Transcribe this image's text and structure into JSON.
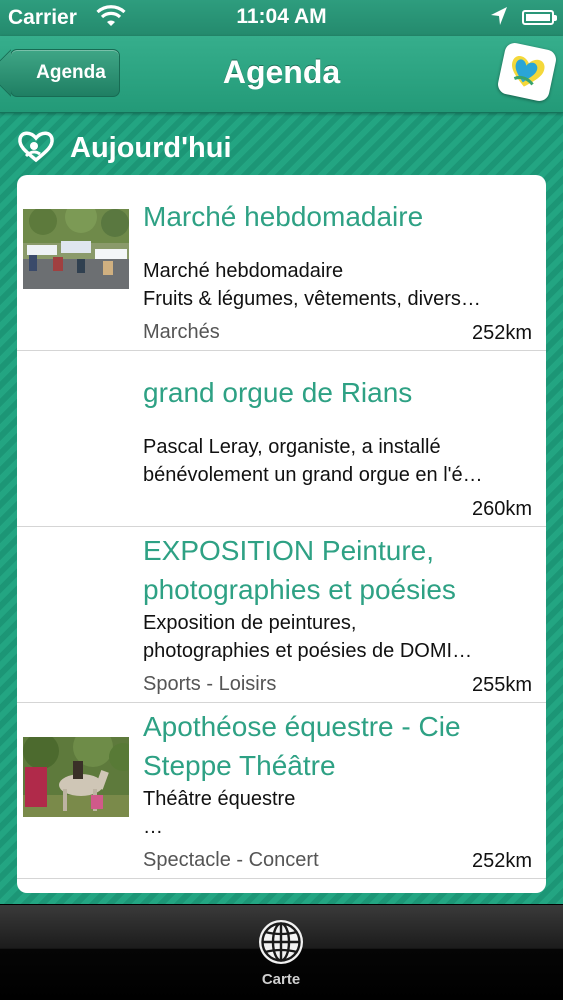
{
  "status_bar": {
    "carrier": "Carrier",
    "time": "11:04 AM"
  },
  "nav": {
    "back_label": "Agenda",
    "title": "Agenda"
  },
  "section": {
    "title": "Aujourd'hui"
  },
  "events": [
    {
      "title_lines": [
        "Marché hebdomadaire"
      ],
      "desc_lines": [
        "Marché hebdomadaire",
        "Fruits & légumes, vêtements, divers…"
      ],
      "category": "Marchés",
      "distance": "252km"
    },
    {
      "title_lines": [
        "grand orgue de Rians"
      ],
      "desc_lines": [
        "Pascal Leray, organiste, a installé",
        "bénévolement un grand orgue en l'é…"
      ],
      "category": "",
      "distance": "260km"
    },
    {
      "title_lines": [
        "EXPOSITION Peinture,",
        "photographies et poésies"
      ],
      "desc_lines": [
        "Exposition de peintures,",
        "photographies et poésies de DOMI…"
      ],
      "category": "Sports - Loisirs",
      "distance": "255km"
    },
    {
      "title_lines": [
        "Apothéose équestre - Cie",
        "Steppe Théâtre"
      ],
      "desc_lines": [
        "Théâtre équestre",
        "…"
      ],
      "category": "Spectacle - Concert",
      "distance": "252km"
    }
  ],
  "tabbar": {
    "tab_label": "Carte"
  },
  "colors": {
    "accent_green": "#2ea184",
    "background_green": "#1f9e7c"
  }
}
